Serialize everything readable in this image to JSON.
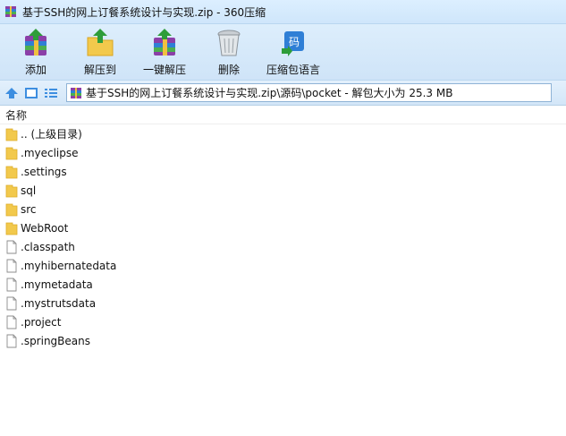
{
  "window": {
    "title": "基于SSH的网上订餐系统设计与实现.zip - 360压缩"
  },
  "toolbar": {
    "items": [
      {
        "label": "添加",
        "icon": "archive-add-icon"
      },
      {
        "label": "解压到",
        "icon": "extract-to-folder-icon"
      },
      {
        "label": "一键解压",
        "icon": "one-click-extract-icon"
      },
      {
        "label": "删除",
        "icon": "trash-bin-icon"
      },
      {
        "label": "压缩包语言",
        "icon": "encoding-language-icon"
      }
    ]
  },
  "pathbar": {
    "path": "基于SSH的网上订餐系统设计与实现.zip\\源码\\pocket - 解包大小为 25.3 MB"
  },
  "list": {
    "column_name": "名称",
    "rows": [
      {
        "name": ".. (上级目录)",
        "type": "folder"
      },
      {
        "name": ".myeclipse",
        "type": "folder"
      },
      {
        "name": ".settings",
        "type": "folder"
      },
      {
        "name": "sql",
        "type": "folder"
      },
      {
        "name": "src",
        "type": "folder"
      },
      {
        "name": "WebRoot",
        "type": "folder"
      },
      {
        "name": ".classpath",
        "type": "file"
      },
      {
        "name": ".myhibernatedata",
        "type": "file"
      },
      {
        "name": ".mymetadata",
        "type": "file"
      },
      {
        "name": ".mystrutsdata",
        "type": "file"
      },
      {
        "name": ".project",
        "type": "file"
      },
      {
        "name": ".springBeans",
        "type": "file"
      }
    ]
  },
  "colors": {
    "titlebar_bg": "#d5eafd",
    "toolbar_bg": "#d6e9fa",
    "folder": "#f2c94c",
    "accent": "#3d8ee0"
  }
}
